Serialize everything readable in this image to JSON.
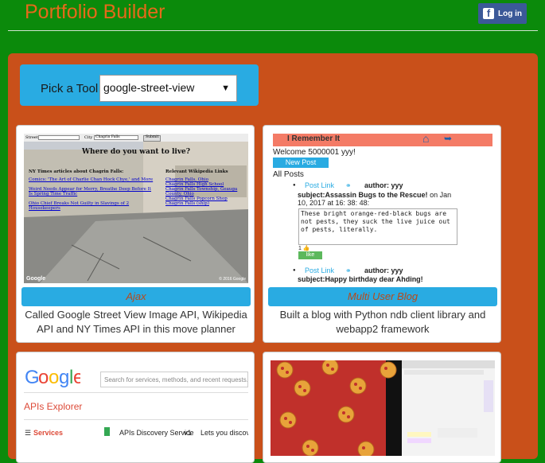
{
  "header": {
    "title": "Portfolio Builder",
    "fb_login": "Log in"
  },
  "picker": {
    "label": "Pick a Tool",
    "selected": "google-street-view"
  },
  "cards": [
    {
      "button": "Ajax",
      "desc": "Called Google Street View Image API, Wikipedia API and NY Times API in this move planner",
      "shot": {
        "street_label": "Street",
        "city_label": "City",
        "city_value": "Chagrin Falls",
        "submit": "Submit",
        "heading": "Where do you want to live?",
        "nyt_heading": "NY Times articles about Chagrin Falls:",
        "nyt_links": [
          "Comics: 'The Art of Charlie Chan Hock Chye,' and More",
          "Weird Needs Appear for Merry, Breathe Deep Before It Is Spring Time Traffic",
          "Ohio Chief Breaks Not Guilty in Slavings of 2 Housekeepers"
        ],
        "wiki_heading": "Relevant Wikipedia Links",
        "wiki_links": [
          "Chagrin Falls, Ohio",
          "Chagrin Falls High School",
          "Chagrin Falls Township, Geauga County, Ohio",
          "Chagrin Falls Popcorn Shop",
          "Chagrin Falls (ship)"
        ],
        "google": "Google",
        "copyright": "© 2016 Google"
      }
    },
    {
      "button": "Multi User Blog",
      "desc": "Built a blog with Python ndb client library and webapp2 framework",
      "shot": {
        "brand": "I Remember It",
        "welcome": "Welcome 5000001 yyy!",
        "new_post": "New Post",
        "all_posts": "All Posts",
        "post1_link": "Post Link",
        "post1_author": "author: yyy",
        "post1_subject": "subject:Assassin Bugs to the Rescue!",
        "post1_date": "on Jan 10, 2017 at 16: 38: 48:",
        "post1_body": "These bright orange-red-black bugs are not pests, they suck the live juice out of pests, literally.",
        "post1_likes": "1",
        "like": "like",
        "post2_link": "Post Link",
        "post2_author": "author: yyy",
        "post2_subject": "subject:Happy birthday dear Ahding!"
      }
    },
    {
      "shot": {
        "search_placeholder": "Search for services, methods, and recent requests...",
        "explorer": "APIs Explorer",
        "services": "Services",
        "row_name": "APIs Discovery Service",
        "row_ver": "v1",
        "row_desc": "Lets you discover inf"
      }
    },
    {
      "shot": {}
    }
  ],
  "colors": {
    "bg": "#0b8a0b",
    "panel": "#c9501a",
    "accent": "#29abe2",
    "title": "#e56a1a",
    "facebook": "#3b5998"
  }
}
